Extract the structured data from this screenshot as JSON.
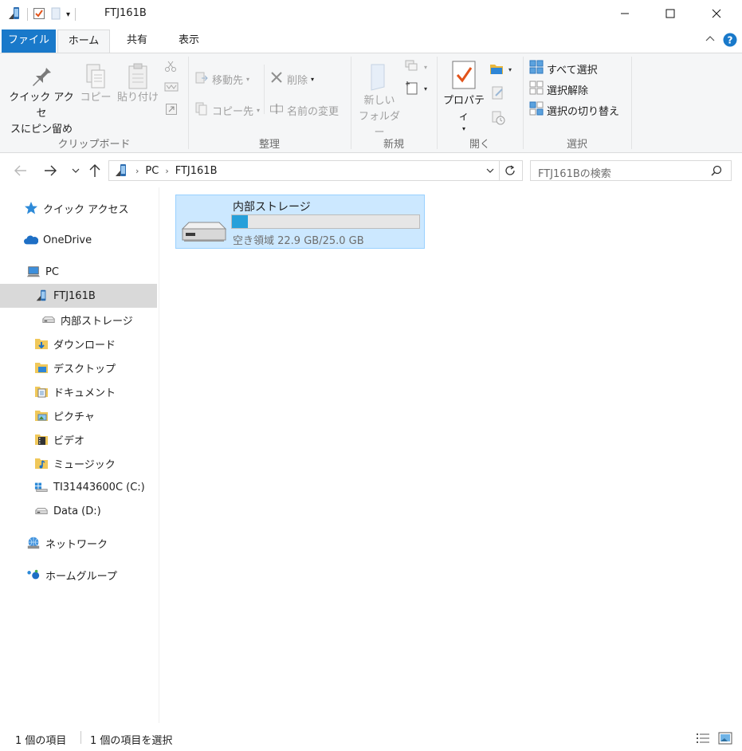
{
  "window": {
    "title": "FTJ161B"
  },
  "tabs": {
    "file": "ファイル",
    "home": "ホーム",
    "share": "共有",
    "view": "表示"
  },
  "ribbon": {
    "clipboard": {
      "pin_line1": "クイック アクセ",
      "pin_line2": "スにピン留め",
      "copy": "コピー",
      "paste": "貼り付け",
      "label": "クリップボード"
    },
    "organize": {
      "move_to": "移動先",
      "copy_to": "コピー先",
      "delete": "削除",
      "rename": "名前の変更",
      "label": "整理"
    },
    "new": {
      "folder_line1": "新しい",
      "folder_line2": "フォルダー",
      "label": "新規"
    },
    "open": {
      "properties": "プロパティ",
      "label": "開く"
    },
    "select": {
      "select_all": "すべて選択",
      "select_none": "選択解除",
      "invert": "選択の切り替え",
      "label": "選択"
    }
  },
  "address": {
    "crumbs": [
      "PC",
      "FTJ161B"
    ]
  },
  "search": {
    "placeholder": "FTJ161Bの検索"
  },
  "sidebar": {
    "items": [
      {
        "label": "クイック アクセス",
        "icon": "star-icon"
      },
      {
        "label": "OneDrive",
        "icon": "cloud-icon"
      },
      {
        "label": "PC",
        "icon": "pc-icon"
      },
      {
        "label": "FTJ161B",
        "icon": "phone-device-icon"
      },
      {
        "label": "内部ストレージ",
        "icon": "drive-icon"
      },
      {
        "label": "ダウンロード",
        "icon": "download-folder-icon"
      },
      {
        "label": "デスクトップ",
        "icon": "desktop-folder-icon"
      },
      {
        "label": "ドキュメント",
        "icon": "documents-folder-icon"
      },
      {
        "label": "ピクチャ",
        "icon": "pictures-folder-icon"
      },
      {
        "label": "ビデオ",
        "icon": "videos-folder-icon"
      },
      {
        "label": "ミュージック",
        "icon": "music-folder-icon"
      },
      {
        "label": "TI31443600C (C:)",
        "icon": "windows-drive-icon"
      },
      {
        "label": "Data (D:)",
        "icon": "drive-icon"
      },
      {
        "label": "ネットワーク",
        "icon": "network-icon"
      },
      {
        "label": "ホームグループ",
        "icon": "homegroup-icon"
      }
    ]
  },
  "content": {
    "tile": {
      "name": "内部ストレージ",
      "free_text": "空き領域 22.9 GB/25.0 GB",
      "used_fraction": 0.084
    }
  },
  "status": {
    "count": "1 個の項目",
    "selected": "1 個の項目を選択"
  },
  "colors": {
    "accent": "#1979ca",
    "selection": "#cce8ff",
    "bar_fill": "#26a0da"
  }
}
